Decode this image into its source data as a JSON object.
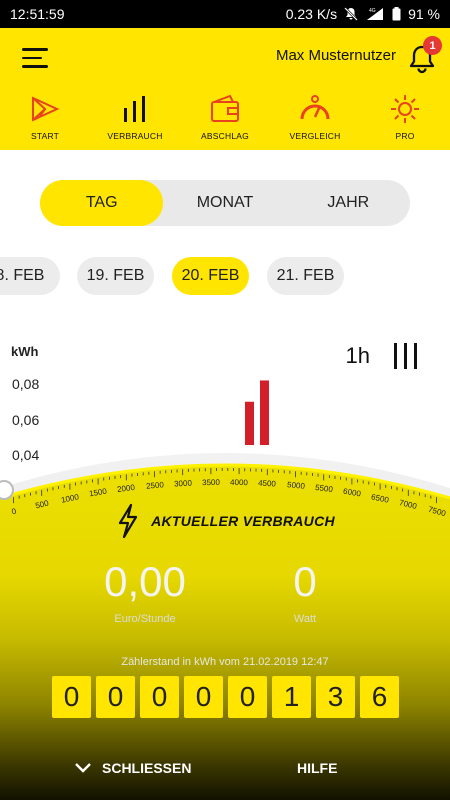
{
  "status_bar": {
    "time": "12:51:59",
    "speed": "0.23 K/s",
    "network": "4G",
    "battery": "91 %"
  },
  "header": {
    "user_name": "Max Musternutzer",
    "notification_count": "1"
  },
  "nav": [
    {
      "label": "START",
      "icon": "start-icon"
    },
    {
      "label": "VERBRAUCH",
      "icon": "bars-icon"
    },
    {
      "label": "ABSCHLAG",
      "icon": "wallet-icon"
    },
    {
      "label": "VERGLEICH",
      "icon": "gauge-icon"
    },
    {
      "label": "PRO",
      "icon": "sun-icon"
    }
  ],
  "segments": [
    {
      "label": "TAG",
      "active": true
    },
    {
      "label": "MONAT",
      "active": false
    },
    {
      "label": "JAHR",
      "active": false
    }
  ],
  "dates": [
    {
      "label": "8. FEB",
      "active": false
    },
    {
      "label": "19. FEB",
      "active": false
    },
    {
      "label": "20. FEB",
      "active": true
    },
    {
      "label": "21. FEB",
      "active": false
    }
  ],
  "chart": {
    "ylabel": "kWh",
    "interval": "1h",
    "yticks": [
      "0,08",
      "0,06",
      "0,04"
    ]
  },
  "chart_data": {
    "type": "bar",
    "ylabel": "kWh",
    "yticks": [
      0.08,
      0.06,
      0.04
    ],
    "values": [
      0.07,
      0.082
    ]
  },
  "gauge": {
    "ticks": [
      "0",
      "500",
      "1000",
      "1500",
      "2000",
      "2500",
      "3000",
      "3500",
      "4000",
      "4500",
      "5000",
      "5500",
      "6000",
      "6500",
      "7000",
      "7500"
    ]
  },
  "panel": {
    "title": "AKTUELLER VERBRAUCH",
    "euro_value": "0,00",
    "euro_label": "Euro/Stunde",
    "watt_value": "0",
    "watt_label": "Watt",
    "reading_caption": "Zählerstand in kWh vom 21.02.2019 12:47",
    "digits": [
      "0",
      "0",
      "0",
      "0",
      "0",
      "1",
      "3",
      "6"
    ],
    "close_label": "SCHLIESSEN",
    "help_label": "HILFE"
  },
  "colors": {
    "accent": "#ffe500",
    "bar": "#d21f2a"
  }
}
